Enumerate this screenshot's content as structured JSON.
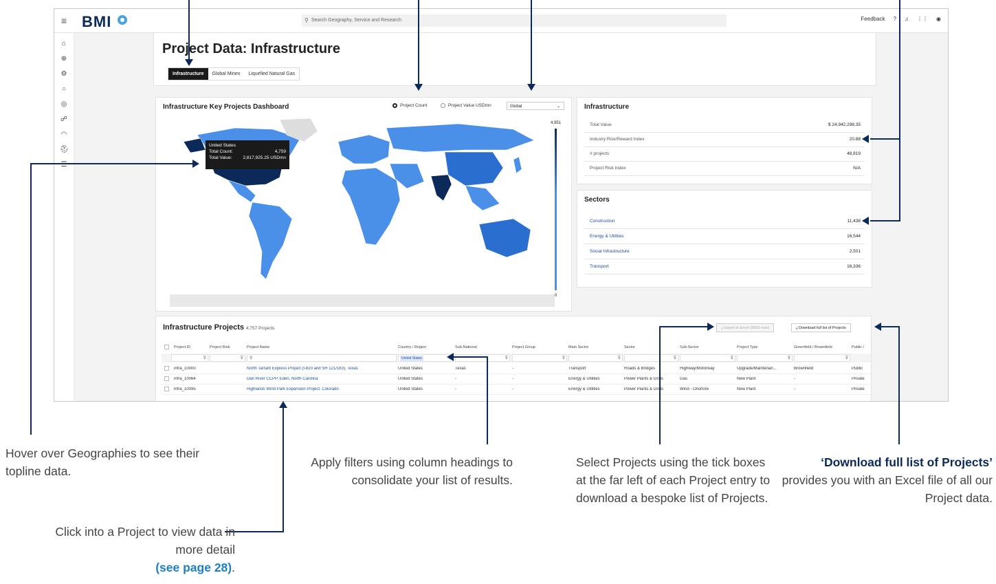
{
  "app": {
    "logo": "BMI",
    "search_placeholder": "Search Geography, Service and Research",
    "feedback_label": "Feedback"
  },
  "page": {
    "title": "Project Data: Infrastructure",
    "tabs": [
      {
        "label": "Infrastructure",
        "active": true
      },
      {
        "label": "Global Mines",
        "active": false
      },
      {
        "label": "Liquefied Natural Gas",
        "active": false
      }
    ]
  },
  "dashboard": {
    "title": "Infrastructure Key Projects Dashboard",
    "radio_count_label": "Project Count",
    "radio_value_label": "Project Value USDmn",
    "region_select_value": "Global",
    "legend_max": "4,951",
    "legend_min": "0",
    "tooltip": {
      "country": "United States",
      "count_label": "Total Count:",
      "count_value": "4,759",
      "value_label": "Total Value:",
      "value_value": "2,817,925.25 USDmn"
    }
  },
  "summary": {
    "title": "Infrastructure",
    "rows": [
      {
        "label": "Total Value",
        "value": "$ 24,942,298.35"
      },
      {
        "label": "Industry Risk/Reward Index",
        "value": "20.88"
      },
      {
        "label": "# projects",
        "value": "48,819"
      },
      {
        "label": "Project Risk Index",
        "value": "N/A"
      }
    ]
  },
  "sectors": {
    "title": "Sectors",
    "rows": [
      {
        "label": "Construction",
        "value": "11,438"
      },
      {
        "label": "Energy & Utilities",
        "value": "16,544"
      },
      {
        "label": "Social Infrastructure",
        "value": "2,501"
      },
      {
        "label": "Transport",
        "value": "18,336"
      }
    ]
  },
  "projects": {
    "title": "Infrastructure Projects",
    "count": "4,757 Projects",
    "export_label": "Export to Excel (5000 max)",
    "download_label": "Download full list of Projects",
    "columns": [
      "Project ID",
      "Project Risk",
      "Project Name",
      "Country / Region",
      "Sub-National",
      "Project Group",
      "Main Sector",
      "Sector",
      "Sub-Sector",
      "Project Type",
      "Greenfield / Brownfield",
      "Public /"
    ],
    "country_filter": "United States",
    "rows": [
      {
        "id": "infra_10000",
        "name": "North Tarrant Express Project (I-820 and SH 121/183), Texas",
        "country": "United States",
        "subnational": "Texas",
        "group": "-",
        "main_sector": "Transport",
        "sector": "Roads & Bridges",
        "subsector": "Highway/Motorway",
        "type": "Upgrade/Maintenan...",
        "field": "Brownfield",
        "public": "Public"
      },
      {
        "id": "infra_10064",
        "name": "Dan River CCPP, Eden, North Carolina",
        "country": "United States",
        "subnational": "-",
        "group": "-",
        "main_sector": "Energy & Utilities",
        "sector": "Power Plants & Grids",
        "subsector": "Gas",
        "type": "New Plant",
        "field": "-",
        "public": "Private"
      },
      {
        "id": "infra_10095",
        "name": "Highlands Wind Park Expansion Project, Colorado",
        "country": "United States",
        "subnational": "-",
        "group": "-",
        "main_sector": "Energy & Utilities",
        "sector": "Power Plants & Grids",
        "subsector": "Wind - Onshore",
        "type": "New Plant",
        "field": "-",
        "public": "Private"
      }
    ]
  },
  "annotations": {
    "hover": "Hover over Geographies to see their topline data.",
    "click_line1": "Click into a Project to view data in more detail",
    "click_link": "(see page 28)",
    "click_end": ".",
    "filters": "Apply filters using column headings to consolidate your list of results.",
    "select": "Select Projects using the tick boxes at the far left of each Project entry to download a bespoke list of Projects.",
    "download_bold": "‘Download full list of Projects’",
    "download_rest": "provides you with an Excel file of all our Project data."
  },
  "colors": {
    "navy": "#0b2a5a",
    "map_blue": "#4a8fe8",
    "link_blue": "#1f4fa0",
    "accent_blue": "#1f7fc3"
  }
}
